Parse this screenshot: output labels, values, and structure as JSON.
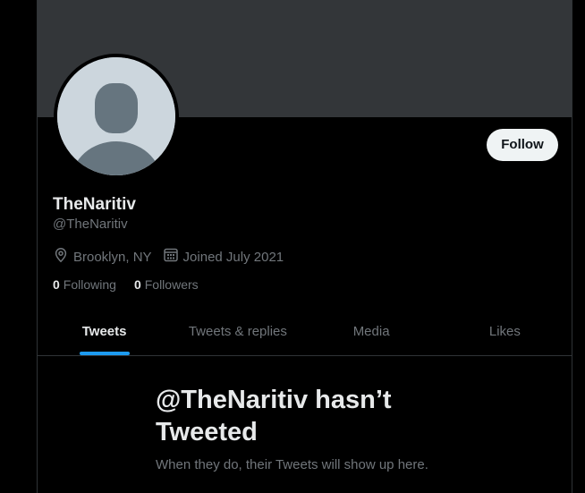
{
  "profile": {
    "display_name": "TheNaritiv",
    "handle": "@TheNaritiv",
    "location": "Brooklyn, NY",
    "joined": "Joined July 2021",
    "following_count": "0",
    "following_label": "Following",
    "followers_count": "0",
    "followers_label": "Followers"
  },
  "actions": {
    "follow_label": "Follow"
  },
  "tabs": [
    {
      "label": "Tweets",
      "active": true
    },
    {
      "label": "Tweets & replies",
      "active": false
    },
    {
      "label": "Media",
      "active": false
    },
    {
      "label": "Likes",
      "active": false
    }
  ],
  "empty_state": {
    "title": "@TheNaritiv hasn’t Tweeted",
    "subtitle": "When they do, their Tweets will show up here."
  },
  "icons": {
    "location": "location-pin-icon",
    "calendar": "calendar-icon"
  },
  "colors": {
    "accent": "#1d9bf0",
    "background": "#000000",
    "banner": "#333639",
    "secondary_text": "#71767b"
  }
}
